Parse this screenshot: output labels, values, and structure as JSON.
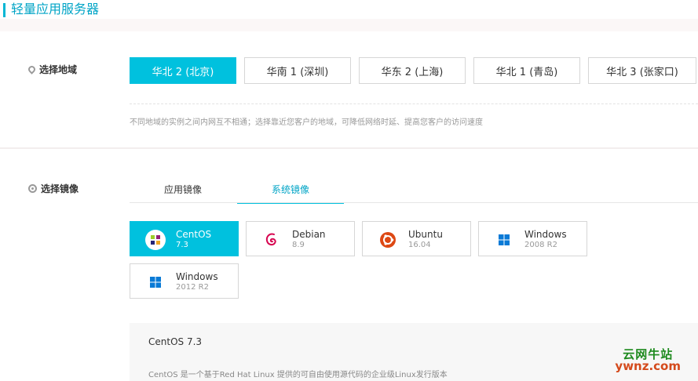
{
  "header": {
    "title": "轻量应用服务器"
  },
  "region": {
    "label": "选择地域",
    "options": [
      {
        "label": "华北 2 (北京)",
        "active": true
      },
      {
        "label": "华南 1 (深圳)",
        "active": false
      },
      {
        "label": "华东 2 (上海)",
        "active": false
      },
      {
        "label": "华北 1 (青岛)",
        "active": false
      },
      {
        "label": "华北 3 (张家口)",
        "active": false
      }
    ],
    "hint": "不同地域的实例之间内网互不相通；选择靠近您客户的地域，可降低网络时延、提高您客户的访问速度"
  },
  "image": {
    "label": "选择镜像",
    "tabs": [
      {
        "label": "应用镜像",
        "active": false
      },
      {
        "label": "系统镜像",
        "active": true
      }
    ],
    "os_list": [
      {
        "name": "CentOS",
        "version": "7.3",
        "icon": "centos-icon",
        "active": true
      },
      {
        "name": "Debian",
        "version": "8.9",
        "icon": "debian-icon",
        "active": false
      },
      {
        "name": "Ubuntu",
        "version": "16.04",
        "icon": "ubuntu-icon",
        "active": false
      },
      {
        "name": "Windows",
        "version": "2008 R2",
        "icon": "windows-icon",
        "active": false
      },
      {
        "name": "Windows",
        "version": "2012 R2",
        "icon": "windows-icon",
        "active": false
      }
    ],
    "detail": {
      "title": "CentOS 7.3",
      "text": "CentOS 是一个基于Red Hat Linux 提供的可自由使用源代码的企业级Linux发行版本"
    }
  },
  "watermark": {
    "cn": "云网牛站",
    "en": "ywnz.com"
  },
  "colors": {
    "accent": "#00c1de",
    "title": "#00a4c6",
    "border": "#d6d6d6"
  }
}
